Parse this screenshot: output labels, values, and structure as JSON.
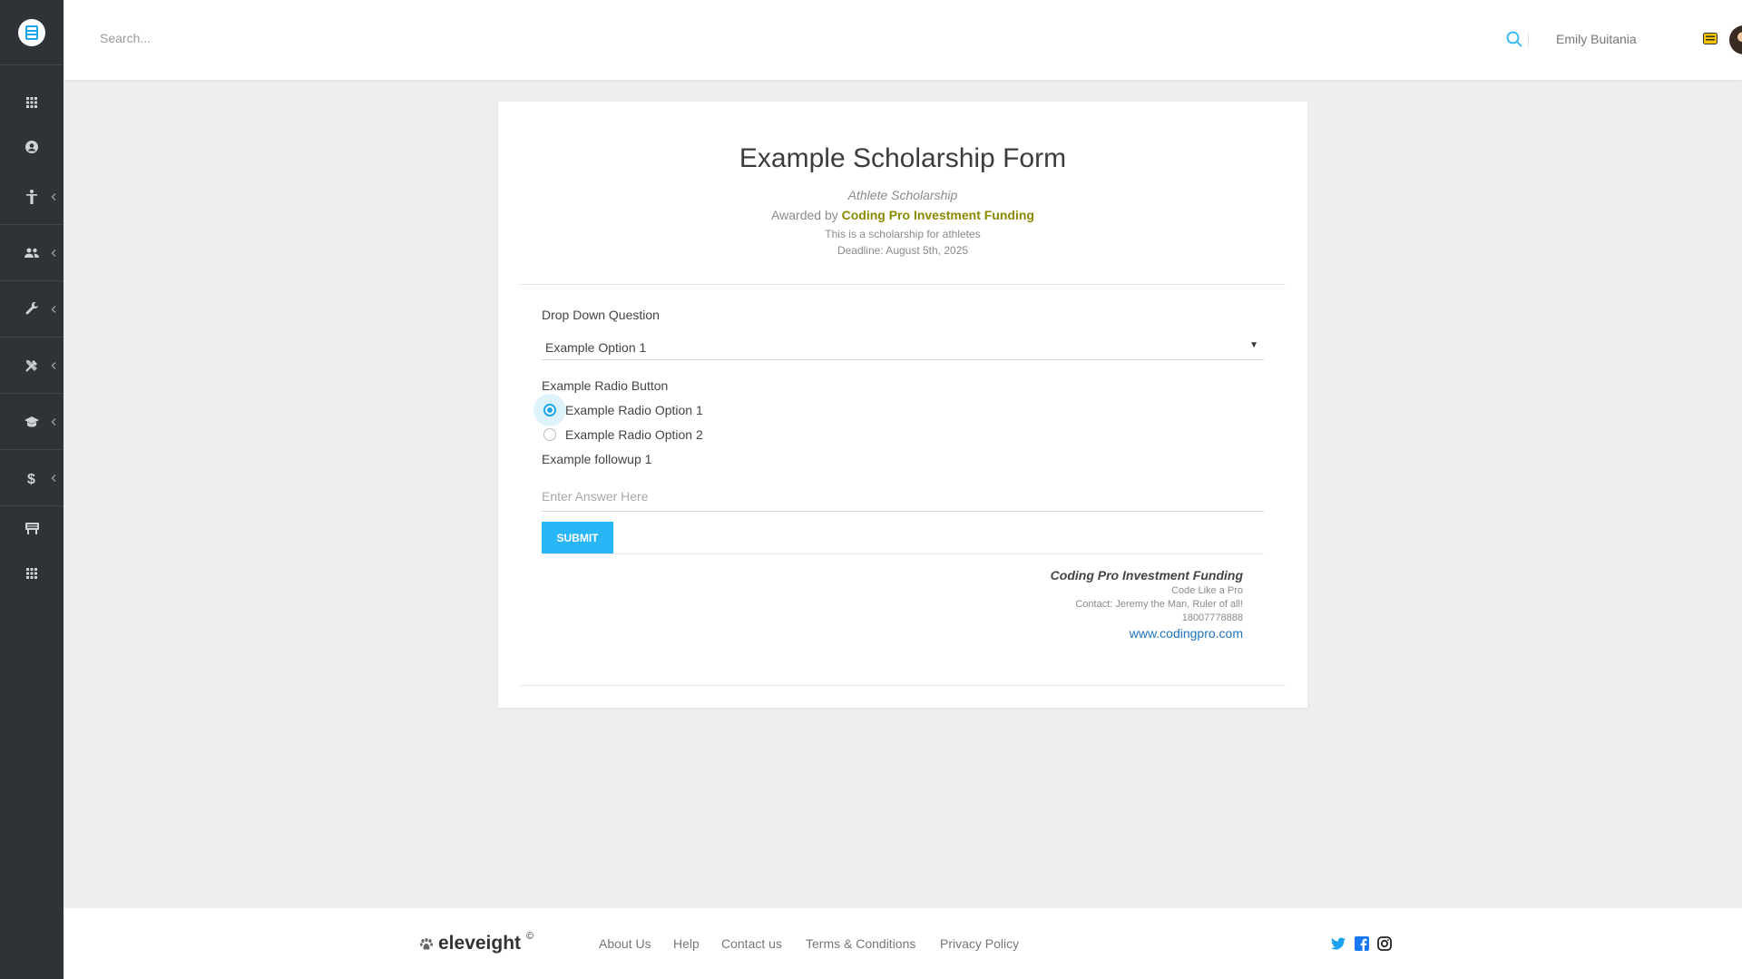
{
  "header": {
    "search_placeholder": "Search...",
    "user_name": "Emily Buitania"
  },
  "sidebar": {
    "items": [
      {
        "icon": "apps-grid-icon"
      },
      {
        "icon": "account-icon"
      },
      {
        "icon": "accessibility-icon",
        "has_chevron": true
      },
      {
        "icon": "people-icon",
        "has_chevron": true
      },
      {
        "icon": "wrench-icon",
        "has_chevron": true
      },
      {
        "icon": "tools-icon",
        "has_chevron": true
      },
      {
        "icon": "graduation-cap-icon",
        "has_chevron": true
      },
      {
        "icon": "dollar-icon",
        "has_chevron": true
      },
      {
        "icon": "billboard-icon"
      },
      {
        "icon": "apps-grid-icon"
      }
    ]
  },
  "form": {
    "title": "Example Scholarship Form",
    "subtitle": "Athlete Scholarship",
    "awarded_prefix": "Awarded by",
    "awarded_org": "Coding Pro Investment Funding",
    "description": "This is a scholarship for athletes",
    "deadline": "Deadline: August 5th, 2025",
    "dropdown": {
      "label": "Drop Down Question",
      "selected": "Example Option 1"
    },
    "radio": {
      "label": "Example Radio Button",
      "options": [
        {
          "label": "Example Radio Option 1",
          "checked": true
        },
        {
          "label": "Example Radio Option 2",
          "checked": false
        }
      ]
    },
    "followup": {
      "label": "Example followup 1",
      "placeholder": "Enter Answer Here"
    },
    "submit_label": "SUBMIT",
    "org_footer": {
      "name": "Coding Pro Investment Funding",
      "tagline": "Code Like a Pro",
      "contact": "Contact: Jeremy the Man, Ruler of all!",
      "phone": "18007778888",
      "website": "www.codingpro.com"
    }
  },
  "footer": {
    "brand": "eleveight",
    "brand_mark": "©",
    "links": [
      "About Us",
      "Help",
      "Contact us",
      "Terms & Conditions",
      "Privacy Policy"
    ],
    "social": [
      "twitter-icon",
      "facebook-icon",
      "instagram-icon"
    ]
  },
  "colors": {
    "accent": "#29b6f6",
    "sidebar": "#2f3338",
    "org_highlight": "#8a8a00",
    "link": "#1e73be"
  }
}
